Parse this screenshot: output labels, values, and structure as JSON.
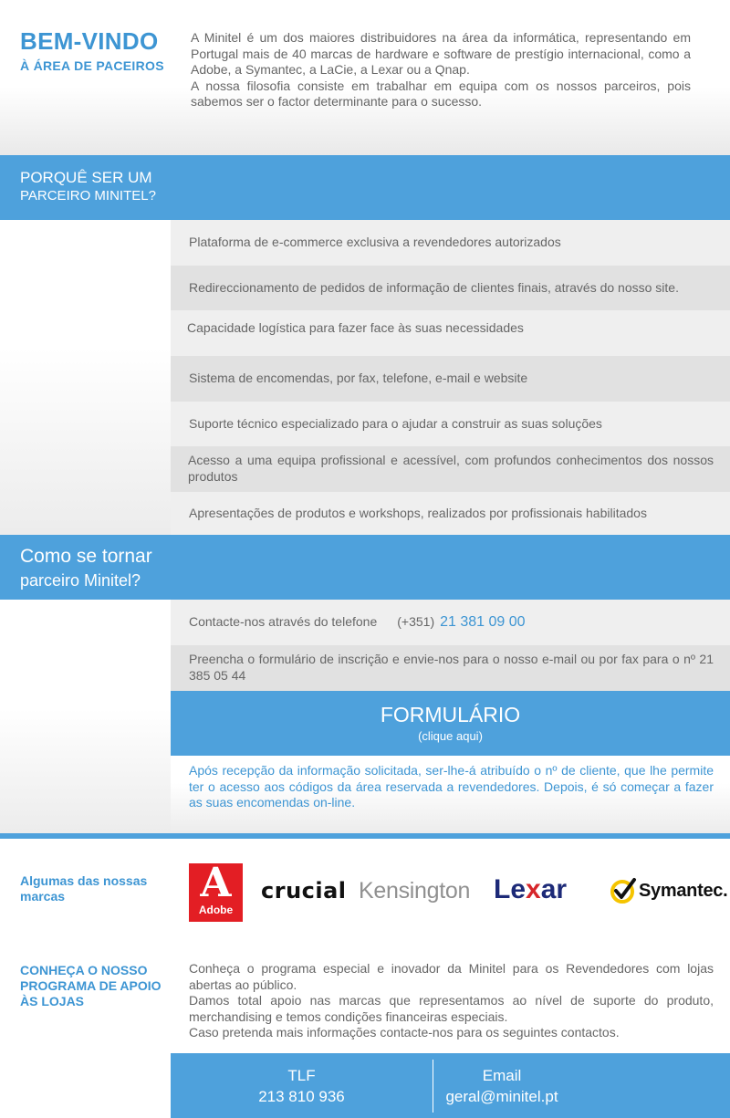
{
  "intro": {
    "title": "BEM-VINDO",
    "subtitle": "À ÁREA DE PACEIROS",
    "paragraph1": "A Minitel é um dos maiores distribuidores na área da informática, representando em Portugal mais de 40 marcas de hardware e software de prestígio internacional, como a Adobe, a Symantec, a LaCie, a Lexar ou a Qnap.",
    "paragraph2": "A nossa filosofia consiste em trabalhar em equipa com os nossos parceiros, pois sabemos ser o factor determinante para o sucesso."
  },
  "why": {
    "title_line1": "PORQUÊ SER UM",
    "title_line2": "PARCEIRO MINITEL?",
    "items": [
      "Plataforma de e-commerce exclusiva a revendedores autorizados",
      "Redireccionamento de pedidos de informação de clientes finais, através do nosso site.",
      "Capacidade logística para fazer face às suas necessidades",
      "Sistema de encomendas, por fax, telefone, e-mail e website",
      "Suporte técnico especializado para o ajudar a construir as suas soluções",
      "Acesso a uma equipa profissional e acessível, com profundos conhecimentos dos nossos produtos",
      "Apresentações de produtos e workshops, realizados por profissionais habilitados"
    ]
  },
  "how": {
    "title_line1": "Como se tornar",
    "title_line2": "parceiro Minitel?",
    "step1_text": "Contacte-nos através do telefone",
    "step1_prefix": "(+351)",
    "step1_phone": "21 381 09 00",
    "step2_text": "Preencha o formulário de inscrição e envie-nos para o nosso e-mail ou por fax para o nº 21 385 05 44",
    "form_title": "FORMULÁRIO",
    "form_subtitle": "(clique aqui)",
    "after_text": "Após recepção da informação solicitada, ser-lhe-á atribuído o nº de cliente, que lhe permite ter o acesso aos códigos da área reservada a revendedores. Depois, é só começar a fazer as suas encomendas on-line."
  },
  "brands": {
    "title": "Algumas das nossas marcas",
    "logos": [
      {
        "name": "Adobe",
        "mark": "A",
        "icon": "adobe-logo",
        "color": "#e31e24"
      },
      {
        "name": "crucial",
        "icon": "crucial-logo",
        "color": "#111111"
      },
      {
        "name": "Kensington",
        "icon": "kensington-logo",
        "color": "#909090"
      },
      {
        "name": "Lexar",
        "part1": "Le",
        "part2": "x",
        "part3": "ar",
        "icon": "lexar-logo",
        "color": "#1d2a78"
      },
      {
        "name": "Symantec.",
        "icon": "symantec-logo",
        "color": "#f5c400"
      }
    ]
  },
  "program": {
    "title": "CONHEÇA O NOSSO PROGRAMA DE APOIO ÀS LOJAS",
    "p1": "Conheça o programa especial e inovador da Minitel para os Revendedores com lojas abertas ao público.",
    "p2": "Damos total apoio nas marcas que representamos ao nível de suporte do produto, merchandising e temos condições financeiras especiais.",
    "p3": "Caso pretenda mais informações contacte-nos para os seguintes contactos."
  },
  "contact": {
    "tlf_label": "TLF",
    "tlf_value": "213 810 936",
    "email_label": "Email",
    "email_value": "geral@minitel.pt"
  },
  "colors": {
    "accent": "#4ea1dc",
    "accent_text": "#3d95d3",
    "row_light": "#efefef",
    "row_dark": "#e1e1e1"
  }
}
